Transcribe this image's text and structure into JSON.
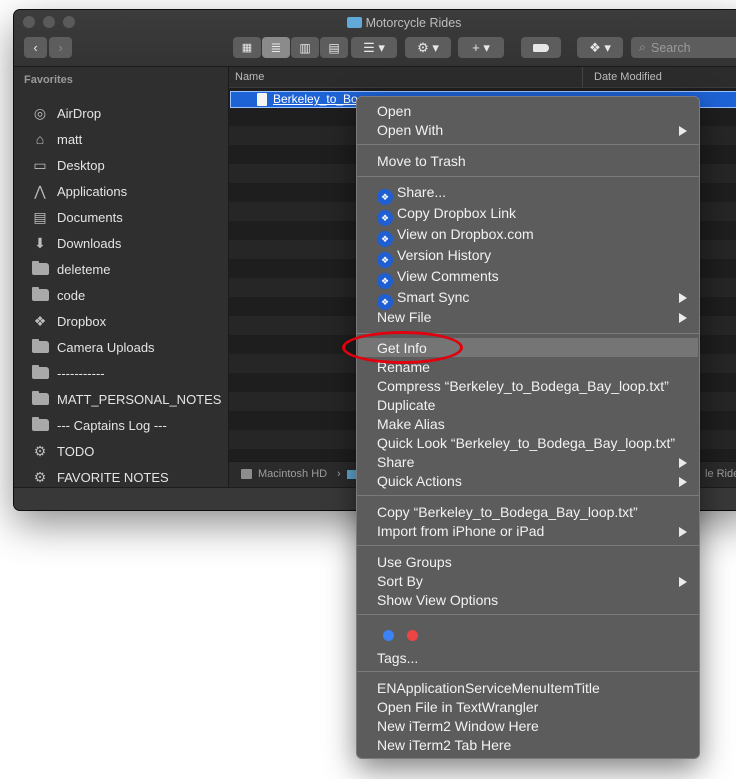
{
  "window": {
    "title": "Motorcycle Rides",
    "search_placeholder": "Search",
    "toolbar_icons": [
      "icon-view",
      "list-view",
      "column-view",
      "gallery-view",
      "group-by",
      "action-gear",
      "add-plus",
      "tags",
      "dropbox"
    ]
  },
  "sidebar": {
    "section_title": "Favorites",
    "items": [
      {
        "label": "AirDrop",
        "icon": "airdrop-icon"
      },
      {
        "label": "matt",
        "icon": "home-icon"
      },
      {
        "label": "Desktop",
        "icon": "desktop-icon"
      },
      {
        "label": "Applications",
        "icon": "applications-icon"
      },
      {
        "label": "Documents",
        "icon": "documents-icon"
      },
      {
        "label": "Downloads",
        "icon": "downloads-icon"
      },
      {
        "label": "deleteme",
        "icon": "folder-icon"
      },
      {
        "label": "code",
        "icon": "folder-icon"
      },
      {
        "label": "Dropbox",
        "icon": "dropbox-icon"
      },
      {
        "label": "Camera Uploads",
        "icon": "folder-icon"
      },
      {
        "label": "-----------",
        "icon": "folder-icon"
      },
      {
        "label": "MATT_PERSONAL_NOTES",
        "icon": "folder-icon"
      },
      {
        "label": "--- Captains Log ---",
        "icon": "folder-icon"
      },
      {
        "label": "TODO",
        "icon": "gear-icon"
      },
      {
        "label": "FAVORITE NOTES",
        "icon": "gear-icon"
      }
    ]
  },
  "list": {
    "col_name": "Name",
    "col_date": "Date Modified",
    "file_name": "Berkeley_to_Bo",
    "path_root": "Macintosh HD",
    "path_sep": "›",
    "path_tail": "le Rides"
  },
  "context_menu": {
    "items": [
      {
        "label": "Open"
      },
      {
        "label": "Open With",
        "submenu": true
      },
      {
        "label": "Move to Trash"
      },
      {
        "label": "Share...",
        "dropbox": true
      },
      {
        "label": "Copy Dropbox Link",
        "dropbox": true
      },
      {
        "label": "View on Dropbox.com",
        "dropbox": true
      },
      {
        "label": "Version History",
        "dropbox": true
      },
      {
        "label": "View Comments",
        "dropbox": true
      },
      {
        "label": "Smart Sync",
        "dropbox": true,
        "submenu": true
      },
      {
        "label": "New File",
        "submenu": true
      },
      {
        "label": "Get Info",
        "highlighted": true
      },
      {
        "label": "Rename"
      },
      {
        "label": "Compress “Berkeley_to_Bodega_Bay_loop.txt”"
      },
      {
        "label": "Duplicate"
      },
      {
        "label": "Make Alias"
      },
      {
        "label": "Quick Look “Berkeley_to_Bodega_Bay_loop.txt”"
      },
      {
        "label": "Share",
        "submenu": true
      },
      {
        "label": "Quick Actions",
        "submenu": true
      },
      {
        "label": "Copy “Berkeley_to_Bodega_Bay_loop.txt”"
      },
      {
        "label": "Import from iPhone or iPad",
        "submenu": true
      },
      {
        "label": "Use Groups"
      },
      {
        "label": "Sort By",
        "submenu": true
      },
      {
        "label": "Show View Options"
      },
      {
        "label": "Tags..."
      },
      {
        "label": "ENApplicationServiceMenuItemTitle"
      },
      {
        "label": "Open File in TextWrangler"
      },
      {
        "label": "New iTerm2 Window Here"
      },
      {
        "label": "New iTerm2 Tab Here"
      }
    ],
    "tag_colors": [
      "#3b82f6",
      "#ef4444"
    ],
    "annotation_color": "#e0000f"
  }
}
